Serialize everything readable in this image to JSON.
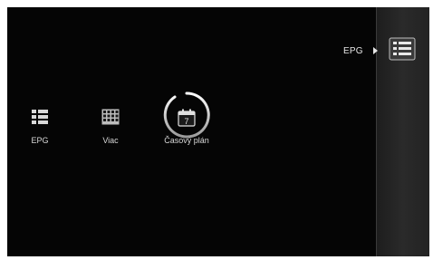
{
  "breadcrumb": {
    "label": "EPG"
  },
  "sidebar": {
    "icon": "epg-list-icon"
  },
  "menu": {
    "items": [
      {
        "label": "EPG",
        "icon": "epg-list-icon"
      },
      {
        "label": "Viac",
        "icon": "grid-table-icon"
      },
      {
        "label": "Časový plán",
        "icon": "calendar-icon",
        "selected": true,
        "calendar_day": "7"
      }
    ]
  },
  "colors": {
    "background": "#050505",
    "sidebar": "#262626",
    "text": "#e6e6e6",
    "selection_ring": "#f2f2f2"
  }
}
